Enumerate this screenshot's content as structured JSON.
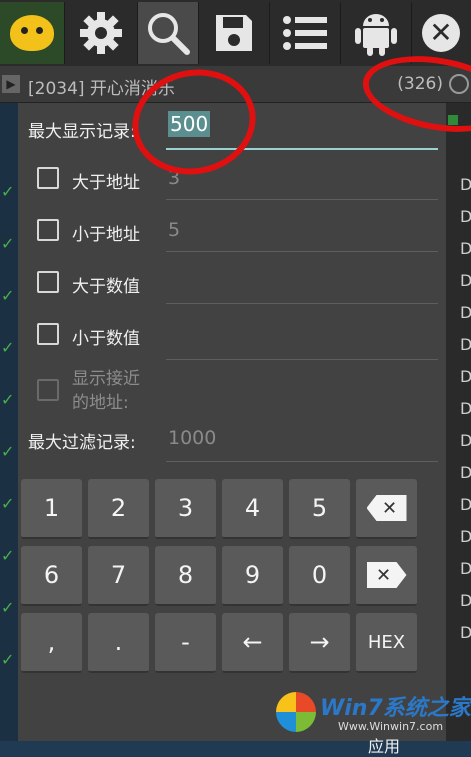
{
  "toolbar": {
    "icons": [
      "app-icon",
      "gear-icon",
      "search-icon",
      "save-icon",
      "list-icon",
      "android-icon",
      "close-icon"
    ]
  },
  "process": {
    "name": "[2034] 开心消消乐",
    "count": "(326)"
  },
  "dialog": {
    "max_records_label": "最大显示记录:",
    "max_records_value": "500",
    "greater_address_label": "大于地址",
    "greater_address_value": "3",
    "less_address_label": "小于地址",
    "less_address_value": "5",
    "greater_value_label": "大于数值",
    "less_value_label": "小于数值",
    "show_nearby_label_1": "显示接近",
    "show_nearby_label_2": "的地址:",
    "max_filter_label": "最大过滤记录:",
    "max_filter_value": "1000"
  },
  "keypad": {
    "row1": [
      "1",
      "2",
      "3",
      "4",
      "5"
    ],
    "row2": [
      "6",
      "7",
      "8",
      "9",
      "0"
    ],
    "row3": [
      ",",
      ".",
      "-",
      "←",
      "→",
      "HEX"
    ],
    "backspace_glyph": "✕",
    "delete_glyph": "✕"
  },
  "apply_label": "应用",
  "right_list": {
    "letter": "D"
  },
  "watermark": {
    "brand": "Win7系统之家",
    "url": "Www.Winwin7.com"
  },
  "colors": {
    "accent": "#9ad1d1",
    "annotation": "#e01010",
    "check": "#48b04a"
  }
}
